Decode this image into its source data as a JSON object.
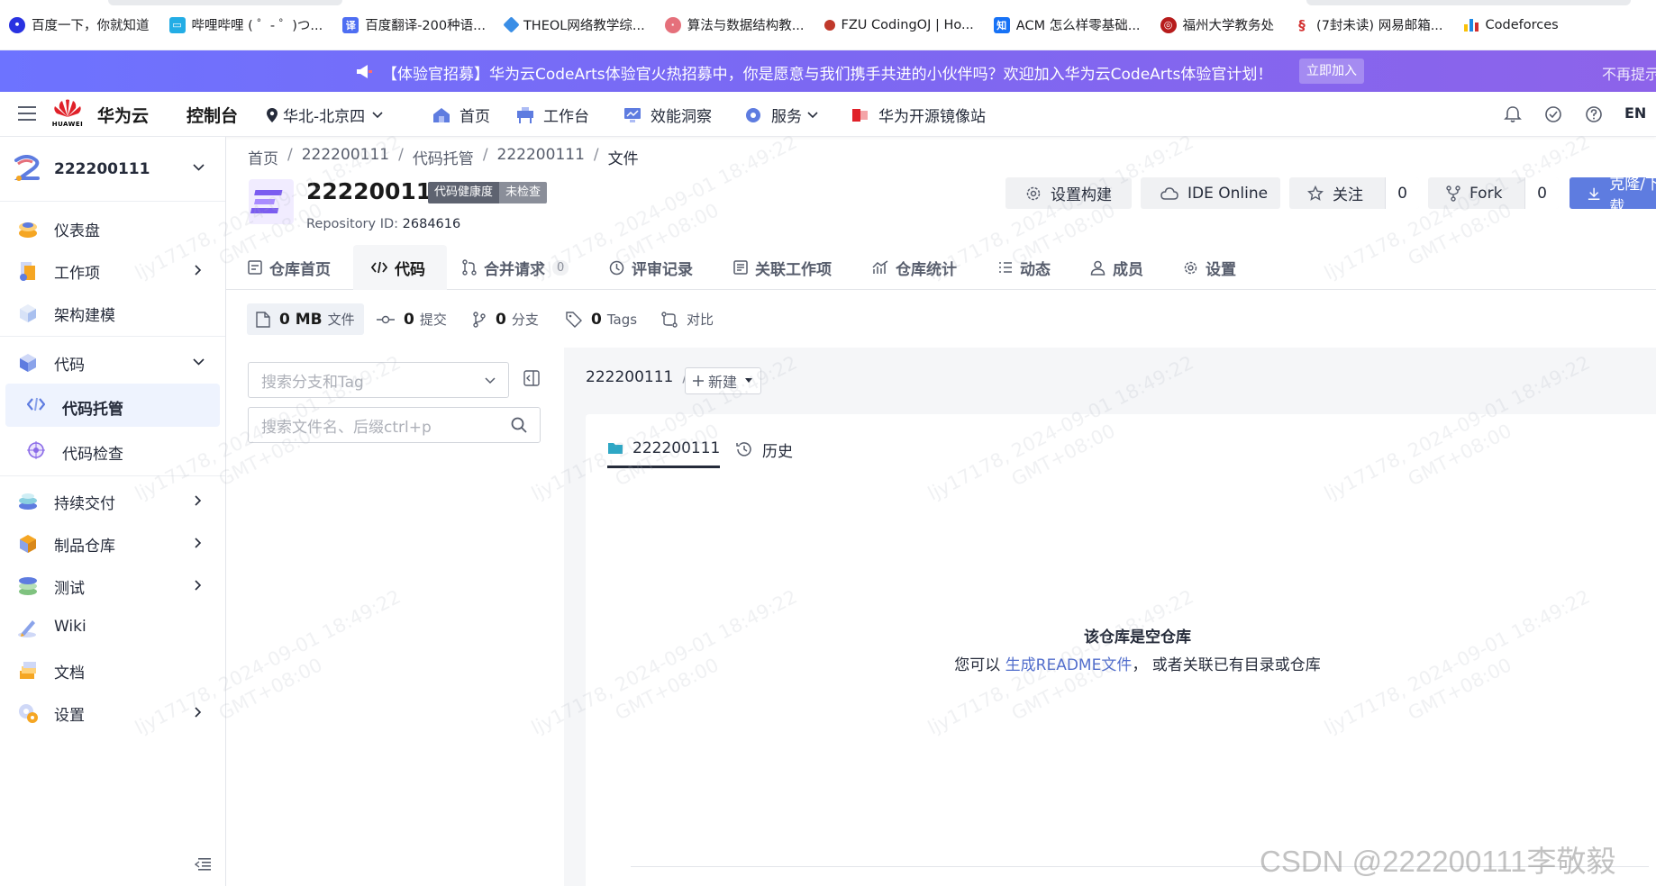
{
  "bookmarks": [
    {
      "label": "百度一下，你就知道",
      "icon": "baidu-paw-icon",
      "color": "#2932e1"
    },
    {
      "label": "哔哩哔哩 ( ゜- ゜)つ...",
      "icon": "bilibili-tv-icon",
      "color": "#23ade5"
    },
    {
      "label": "百度翻译-200种语...",
      "icon": "translate-icon",
      "color": "#4e6ef2"
    },
    {
      "label": "THEOL网络教学综...",
      "icon": "theol-icon",
      "color": "#3a8ee6"
    },
    {
      "label": "算法与数据结构教...",
      "icon": "course-icon",
      "color": "#e5707b"
    },
    {
      "label": "FZU CodingOJ | Ho...",
      "icon": "fzu-icon",
      "color": "#c0392b"
    },
    {
      "label": "ACM 怎么样零基础...",
      "icon": "zhihu-icon",
      "color": "#1772f6"
    },
    {
      "label": "福州大学教务处",
      "icon": "fzu-seal-icon",
      "color": "#b71c1c"
    },
    {
      "label": "(7封未读) 网易邮箱...",
      "icon": "netease-icon",
      "color": "#d32f2f"
    },
    {
      "label": "Codeforces",
      "icon": "codeforces-icon",
      "color": "#1e88e5"
    }
  ],
  "announcement": {
    "message": "【体验官招募】华为云CodeArts体验官火热招募中，你是愿意与我们携手共进的小伙伴吗？欢迎加入华为云CodeArts体验官计划！",
    "join_label": "立即加入",
    "dismiss_label": "不再提示"
  },
  "topnav": {
    "brand_logo_text": "HUAWEI",
    "brand": "华为云",
    "console": "控制台",
    "region": "华北-北京四",
    "items": [
      "首页",
      "工作台",
      "效能洞察",
      "服务",
      "华为开源镜像站"
    ],
    "lang": "EN"
  },
  "sidebar": {
    "project": "222200111",
    "items": [
      {
        "label": "仪表盘",
        "arrow": false
      },
      {
        "label": "工作项",
        "arrow": true
      },
      {
        "label": "架构建模",
        "arrow": false
      },
      {
        "label": "代码",
        "arrow": "down"
      },
      {
        "label": "持续交付",
        "arrow": true
      },
      {
        "label": "制品仓库",
        "arrow": true
      },
      {
        "label": "测试",
        "arrow": true
      },
      {
        "label": "Wiki",
        "arrow": false
      },
      {
        "label": "文档",
        "arrow": false
      },
      {
        "label": "设置",
        "arrow": true
      }
    ],
    "subitems": [
      "代码托管",
      "代码检查"
    ]
  },
  "breadcrumb": [
    "首页",
    "222200111",
    "代码托管",
    "222200111",
    "文件"
  ],
  "repo": {
    "name": "222200111",
    "health_label": "代码健康度",
    "health_status": "未检查",
    "id_label": "Repository ID:",
    "id": "2684616"
  },
  "header_buttons": {
    "settings_build": "设置构建",
    "ide_online": "IDE Online",
    "watch": "关注",
    "watch_count": "0",
    "fork": "Fork",
    "fork_count": "0",
    "clone": "克隆/下载"
  },
  "tabs": [
    "仓库首页",
    "代码",
    "合并请求",
    "评审记录",
    "关联工作项",
    "仓库统计",
    "动态",
    "成员",
    "设置"
  ],
  "merge_request_count": "0",
  "stats": {
    "size_value": "0 MB",
    "size_label": "文件",
    "commits_value": "0",
    "commits_label": "提交",
    "branches_value": "0",
    "branches_label": "分支",
    "tags_value": "0",
    "tags_label": "Tags",
    "compare_label": "对比"
  },
  "search": {
    "branch_placeholder": "搜索分支和Tag",
    "file_placeholder": "搜索文件名、后缀ctrl+p"
  },
  "path": {
    "root": "222200111",
    "sep": "/",
    "new_label": "新建"
  },
  "file_tabs": [
    "222200111",
    "历史"
  ],
  "empty": {
    "title": "该仓库是空仓库",
    "prefix": "您可以",
    "link": "生成README文件",
    "suffix": "，  或者关联已有目录或仓库"
  },
  "watermark_text": [
    "ljy17178, 2024-09-01 18:49:22",
    "GMT+08:00"
  ],
  "csdn_watermark": "CSDN @222200111李敬毅",
  "colors": {
    "accent": "#5e7ce0",
    "announce_start": "#6d73ff",
    "announce_end": "#8d63ea",
    "link": "#526ecc"
  }
}
